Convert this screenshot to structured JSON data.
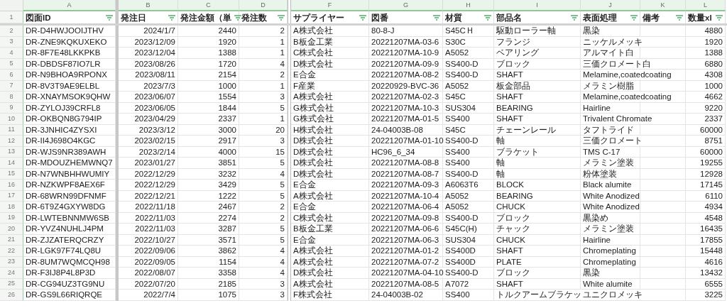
{
  "columns": [
    {
      "letter": "A",
      "header": "図面ID",
      "kind": "text"
    },
    {
      "letter": "B",
      "header": "発注日",
      "kind": "number"
    },
    {
      "letter": "C",
      "header": "発注金額（単",
      "kind": "number"
    },
    {
      "letter": "D",
      "header": "発注数",
      "kind": "number"
    },
    {
      "letter": "F",
      "header": "サプライヤー",
      "kind": "text"
    },
    {
      "letter": "G",
      "header": "図番",
      "kind": "text"
    },
    {
      "letter": "H",
      "header": "材質",
      "kind": "text"
    },
    {
      "letter": "I",
      "header": "部品名",
      "kind": "text"
    },
    {
      "letter": "J",
      "header": "表面処理",
      "kind": "text"
    },
    {
      "letter": "K",
      "header": "備考",
      "kind": "text"
    },
    {
      "letter": "L",
      "header": "数量xl",
      "kind": "number"
    }
  ],
  "header_row": "1",
  "rows": [
    {
      "row": "2",
      "id": "DR-D4HWJOOIJTHV",
      "date": "2024/1/7",
      "amount": "2440",
      "qty": "2",
      "supplier": "A株式会社",
      "drawing": "80-8-J",
      "material": "S45CＨ",
      "part": "駆動ローラー軸",
      "finish": "黒染",
      "total": "4880"
    },
    {
      "row": "3",
      "id": "DR-ZNE9KQKUXEKO",
      "date": "2023/12/09",
      "amount": "1920",
      "qty": "1",
      "supplier": "B板金工業",
      "drawing": "20221207MA-03-6",
      "material": "S30C",
      "part": "フランジ",
      "finish": "ニッケルメッキ",
      "total": "1920"
    },
    {
      "row": "4",
      "id": "DR-8F7E48LKKPKB",
      "date": "2023/12/04",
      "amount": "1388",
      "qty": "1",
      "supplier": "C株式会社",
      "drawing": "20221207MA-10-9",
      "material": "A5052",
      "part": "ベアリング",
      "finish": "アルマイト白",
      "total": "1388"
    },
    {
      "row": "5",
      "id": "DR-DBDSF87IO7LR",
      "date": "2023/08/26",
      "amount": "1720",
      "qty": "4",
      "supplier": "D株式会社",
      "drawing": "20221207MA-09-9",
      "material": "SS400-D",
      "part": "ブロック",
      "finish": "三価クロメート白",
      "total": "6880"
    },
    {
      "row": "6",
      "id": "DR-N9BHOA9RPONX",
      "date": "2023/08/11",
      "amount": "2154",
      "qty": "2",
      "supplier": "E合金",
      "drawing": "20221207MA-08-2",
      "material": "SS400-D",
      "part": "SHAFT",
      "finish": "Melamine,coatedcoating",
      "total": "4308"
    },
    {
      "row": "7",
      "id": "DR-8V3T9AE9ELBL",
      "date": "2023/7/3",
      "amount": "1000",
      "qty": "1",
      "supplier": "F産業",
      "drawing": "20220929-BVC-36",
      "material": "A5052",
      "part": "板金部品",
      "finish": "メラミン樹脂",
      "total": "1000"
    },
    {
      "row": "8",
      "id": "DR-XNAYMSOK9QHW",
      "date": "2023/06/07",
      "amount": "1554",
      "qty": "3",
      "supplier": "A株式会社",
      "drawing": "20221207MA-02-3",
      "material": "S45C",
      "part": "SHAFT",
      "finish": "Melamine,coatedcoating",
      "total": "4662"
    },
    {
      "row": "9",
      "id": "DR-ZYLOJ39CRFL8",
      "date": "2023/06/05",
      "amount": "1844",
      "qty": "5",
      "supplier": "G株式会社",
      "drawing": "20221207MA-10-3",
      "material": "SUS304",
      "part": "BEARING",
      "finish": "Hairline",
      "total": "9220"
    },
    {
      "row": "10",
      "id": "DR-OKBQN8G794IP",
      "date": "2023/04/29",
      "amount": "2337",
      "qty": "1",
      "supplier": "G株式会社",
      "drawing": "20221207MA-01-5",
      "material": "SS400",
      "part": "SHAFT",
      "finish": "Trivalent Chromate",
      "total": "2337"
    },
    {
      "row": "11",
      "id": "DR-3JNHIC4ZYSXI",
      "date": "2023/3/12",
      "amount": "3000",
      "qty": "20",
      "supplier": "H株式会社",
      "drawing": "24-04003B-08",
      "material": "S45C",
      "part": "チェーンレール",
      "finish": "タフトライド",
      "total": "60000"
    },
    {
      "row": "12",
      "id": "DR-II4J698O4KGC",
      "date": "2023/02/15",
      "amount": "2917",
      "qty": "3",
      "supplier": "D株式会社",
      "drawing": "20221207MA-01-10",
      "material": "SS400-D",
      "part": "軸",
      "finish": "三価クロメート",
      "total": "8751"
    },
    {
      "row": "13",
      "id": "DR-WJS9NR389AWH",
      "date": "2023/2/14",
      "amount": "4000",
      "qty": "15",
      "supplier": "D株式会社",
      "drawing": "HC96_6_34",
      "material": "SS400",
      "part": "ブラケット",
      "finish": "TMS C-17",
      "total": "60000"
    },
    {
      "row": "14",
      "id": "DR-MDOUZHEMWNQ7",
      "date": "2023/01/27",
      "amount": "3851",
      "qty": "5",
      "supplier": "D株式会社",
      "drawing": "20221207MA-08-8",
      "material": "SS400",
      "part": "軸",
      "finish": "メラミン塗装",
      "total": "19255"
    },
    {
      "row": "15",
      "id": "DR-N7WNBHHWUMIY",
      "date": "2022/12/29",
      "amount": "3232",
      "qty": "4",
      "supplier": "D株式会社",
      "drawing": "20221207MA-08-7",
      "material": "SS400-D",
      "part": "軸",
      "finish": "粉体塗装",
      "total": "12928"
    },
    {
      "row": "16",
      "id": "DR-NZKWPF8AEX6F",
      "date": "2022/12/29",
      "amount": "3429",
      "qty": "5",
      "supplier": "E合金",
      "drawing": "20221207MA-09-3",
      "material": "A6063T6",
      "part": "BLOCK",
      "finish": "Black alumite",
      "total": "17145"
    },
    {
      "row": "17",
      "id": "DR-68WRN99DFNMF",
      "date": "2022/12/21",
      "amount": "1222",
      "qty": "5",
      "supplier": "A株式会社",
      "drawing": "20221207MA-10-4",
      "material": "A5052",
      "part": "BEARING",
      "finish": "White Anodized",
      "total": "6110"
    },
    {
      "row": "18",
      "id": "DR-6T9Z4GXYW8DG",
      "date": "2022/11/18",
      "amount": "2467",
      "qty": "2",
      "supplier": "E合金",
      "drawing": "20221207MA-06-4",
      "material": "A5052",
      "part": "CHUCK",
      "finish": "White Anodized",
      "total": "4934"
    },
    {
      "row": "19",
      "id": "DR-LWTEBNNMW6SB",
      "date": "2022/11/03",
      "amount": "2274",
      "qty": "2",
      "supplier": "C株式会社",
      "drawing": "20221207MA-09-8",
      "material": "SS400-D",
      "part": "ブロック",
      "finish": "黒染め",
      "total": "4548"
    },
    {
      "row": "20",
      "id": "DR-YVZ4NUHLJ4PM",
      "date": "2022/11/03",
      "amount": "3287",
      "qty": "5",
      "supplier": "B板金工業",
      "drawing": "20221207MA-06-6",
      "material": "S45C(H)",
      "part": "チャック",
      "finish": "メラミン塗装",
      "total": "16435"
    },
    {
      "row": "21",
      "id": "DR-ZJZATERQCRZY",
      "date": "2022/10/27",
      "amount": "3571",
      "qty": "5",
      "supplier": "E合金",
      "drawing": "20221207MA-06-3",
      "material": "SUS304",
      "part": "CHUCK",
      "finish": "Hairline",
      "total": "17855"
    },
    {
      "row": "22",
      "id": "DR-LGK97F74LQ8U",
      "date": "2022/09/06",
      "amount": "3862",
      "qty": "4",
      "supplier": "A株式会社",
      "drawing": "20221207MA-01-2",
      "material": "SS400D",
      "part": "SHAFT",
      "finish": "Chromeplating",
      "total": "15448"
    },
    {
      "row": "23",
      "id": "DR-8UM7WQMCQH98",
      "date": "2022/09/05",
      "amount": "1154",
      "qty": "4",
      "supplier": "A株式会社",
      "drawing": "20221207MA-07-2",
      "material": "SS400D",
      "part": "PLATE",
      "finish": "Chromeplating",
      "total": "4616"
    },
    {
      "row": "24",
      "id": "DR-F3IJ8P4L8P3D",
      "date": "2022/08/07",
      "amount": "3358",
      "qty": "4",
      "supplier": "D株式会社",
      "drawing": "20221207MA-04-10",
      "material": "SS400-D",
      "part": "ブロック",
      "finish": "黒染",
      "total": "13432"
    },
    {
      "row": "25",
      "id": "DR-CG94UZ3TG9NU",
      "date": "2022/07/20",
      "amount": "2185",
      "qty": "3",
      "supplier": "A株式会社",
      "drawing": "20221207MA-08-5",
      "material": "A7072",
      "part": "SHAFT",
      "finish": "White alumite",
      "total": "6555"
    },
    {
      "row": "26",
      "id": "DR-GS9L66RIQRQE",
      "date": "2022/7/4",
      "amount": "1075",
      "qty": "3",
      "supplier": "F株式会社",
      "drawing": "24-04003B-02",
      "material": "SS400",
      "part": "トルクアームブラケッ",
      "finish": "ユニクロメッキ",
      "total": "3225"
    }
  ]
}
